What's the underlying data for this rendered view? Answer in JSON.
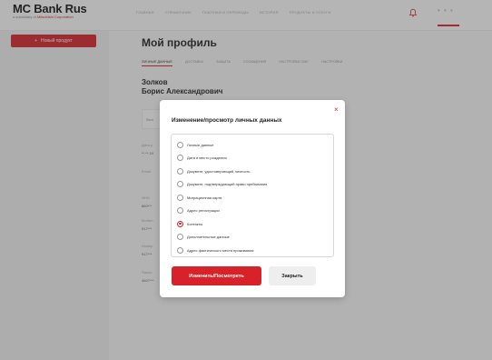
{
  "header": {
    "logo_name": "MC Bank Rus",
    "logo_sub_prefix": "a subsidiary of",
    "logo_sub_brand": "Mitsubishi Corporation",
    "nav": [
      "ГЛАВНАЯ",
      "СПРАВОЧНИК",
      "ПЛАТЕЖИ И ПЕРЕВОДЫ",
      "ИСТОРИЯ",
      "ПРОДУКТЫ И УСЛУГИ"
    ],
    "more": "• • •",
    "accent_color": "#d8222a"
  },
  "sidebar": {
    "new_product_icon": "+",
    "new_product_label": "Новый продукт"
  },
  "profile": {
    "title": "Мой профиль",
    "tabs": [
      "ЛИЧНЫЕ ДАННЫЕ",
      "ДОСТАВКА",
      "ЗАЩИТА",
      "СООБЩЕНИЯ",
      "НАСТРОЙКИ СМС",
      "НАСТРОЙКИ"
    ],
    "last_name": "Золков",
    "first_middle_name": "Борис Александрович",
    "card_label": "Личн",
    "fields": [
      {
        "label": "Дата р",
        "value": "**.**.19"
      },
      {
        "label": "Email",
        "value": ""
      },
      {
        "label": "ИНН",
        "value": "860***"
      },
      {
        "label": "Мобил",
        "value": "917***"
      },
      {
        "label": "Номер",
        "value": "917***"
      },
      {
        "label": "Паспо",
        "value": "4607***"
      }
    ]
  },
  "modal": {
    "title": "Изменение/просмотр личных данных",
    "close_icon": "×",
    "options": [
      {
        "label": "Личные данные",
        "checked": false
      },
      {
        "label": "Дата и место рождения",
        "checked": false
      },
      {
        "label": "Документ, удостоверяющий личность",
        "checked": false
      },
      {
        "label": "Документ, подтверждающий право пребывания",
        "checked": false
      },
      {
        "label": "Миграционная карта",
        "checked": false
      },
      {
        "label": "Адрес регистрации",
        "checked": false
      },
      {
        "label": "Контакты",
        "checked": true
      },
      {
        "label": "Дополнительные данные",
        "checked": false
      },
      {
        "label": "Адрес фактического места проживания",
        "checked": false
      }
    ],
    "primary_button": "Изменить/Посмотреть",
    "secondary_button": "Закрыть"
  }
}
